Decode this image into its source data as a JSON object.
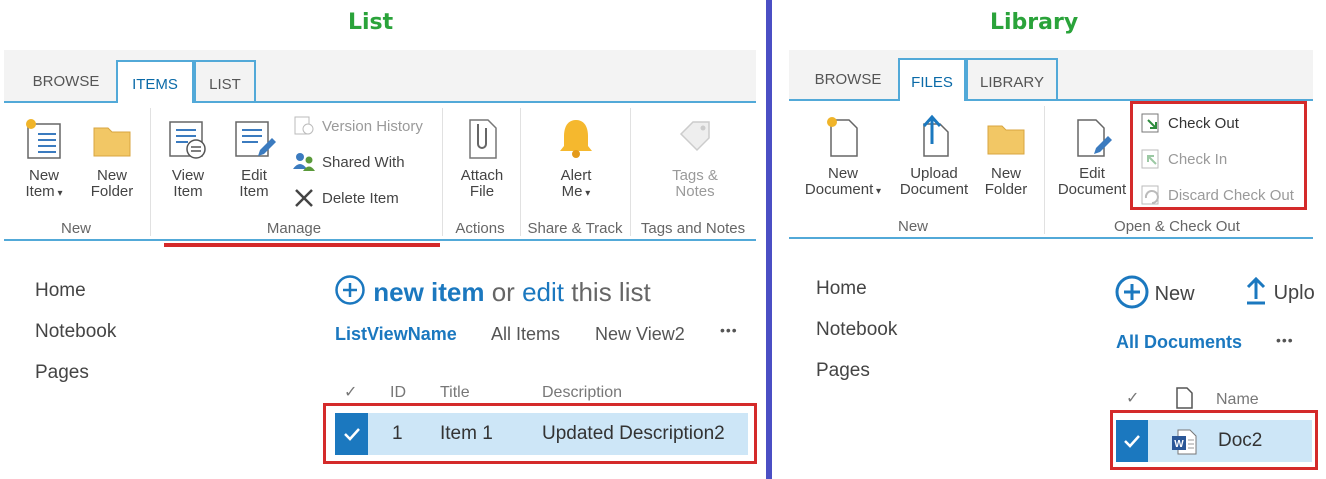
{
  "headings": {
    "left": "List",
    "right": "Library"
  },
  "list_panel": {
    "tabs": [
      "BROWSE",
      "ITEMS",
      "LIST"
    ],
    "ribbon": {
      "new_item": "New\nItem",
      "new_folder": "New\nFolder",
      "group_new": "New",
      "view_item": "View\nItem",
      "edit_item": "Edit\nItem",
      "version_history": "Version History",
      "shared_with": "Shared With",
      "delete_item": "Delete Item",
      "group_manage": "Manage",
      "attach_file": "Attach\nFile",
      "group_actions": "Actions",
      "alert_me": "Alert\nMe",
      "group_share": "Share & Track",
      "tags_notes": "Tags &\nNotes",
      "group_tags": "Tags and Notes"
    },
    "nav": [
      "Home",
      "Notebook",
      "Pages"
    ],
    "command": {
      "new_item": "new item",
      "or": "or",
      "edit": "edit",
      "this_list": "this list"
    },
    "views": [
      "ListViewName",
      "All Items",
      "New View2"
    ],
    "more": "•••",
    "columns": {
      "id": "ID",
      "title": "Title",
      "description": "Description"
    },
    "rows": [
      {
        "id": "1",
        "title": "Item 1",
        "description": "Updated Description2"
      }
    ]
  },
  "library_panel": {
    "tabs": [
      "BROWSE",
      "FILES",
      "LIBRARY"
    ],
    "ribbon": {
      "new_document": "New\nDocument",
      "upload_document": "Upload\nDocument",
      "new_folder": "New\nFolder",
      "group_new": "New",
      "edit_document": "Edit\nDocument",
      "check_out": "Check Out",
      "check_in": "Check In",
      "discard_check_out": "Discard Check Out",
      "group_checkout": "Open & Check Out"
    },
    "nav": [
      "Home",
      "Notebook",
      "Pages"
    ],
    "command": {
      "new": "New",
      "upload": "Uplo"
    },
    "views": [
      "All Documents"
    ],
    "more": "•••",
    "columns": {
      "name": "Name"
    },
    "rows": [
      {
        "name": "Doc2"
      }
    ]
  },
  "colors": {
    "accent": "#1b78bf",
    "tab_border": "#52a9d8",
    "highlight": "#d42a2a",
    "heading": "#2aa33a",
    "divider": "#4b4fc4",
    "selected_row": "#cde6f7"
  }
}
